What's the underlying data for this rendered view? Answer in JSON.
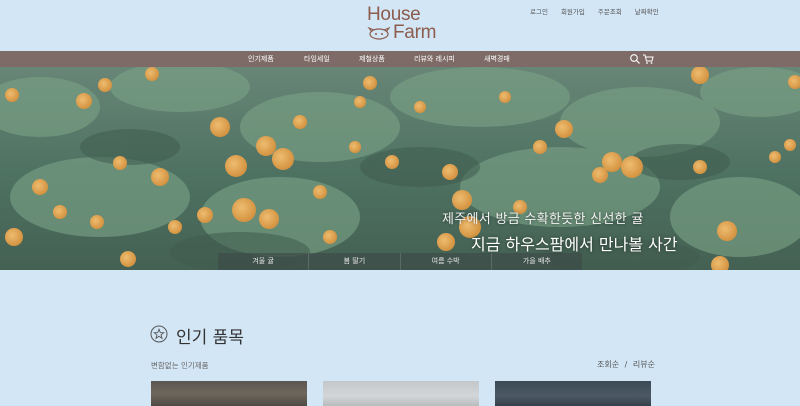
{
  "top_links": [
    "로그인",
    "회원가입",
    "주문조회",
    "날짜확인"
  ],
  "logo": {
    "line1": "House",
    "line2": "Farm"
  },
  "nav": {
    "items": [
      "인기제품",
      "타임세일",
      "제철상품",
      "리뷰와 레시피",
      "새벽경매"
    ]
  },
  "hero": {
    "line1": "제주에서 방금  수확한듯한 신선한 귤",
    "line2": "지금 하우스팜에서 만나볼 사간",
    "tabs": [
      "겨울 귤",
      "봄 딸기",
      "여름 수박",
      "가을 배추"
    ]
  },
  "section": {
    "title": "인기 품목",
    "subtitle": "변함없는 인기제품",
    "sort": {
      "option1": "조회순",
      "separator": "/",
      "option2": "리뷰순"
    }
  },
  "colors": {
    "nav_bg": "#7e6a66",
    "page_bg": "#d3e6f6",
    "logo": "#8c5c4c"
  }
}
